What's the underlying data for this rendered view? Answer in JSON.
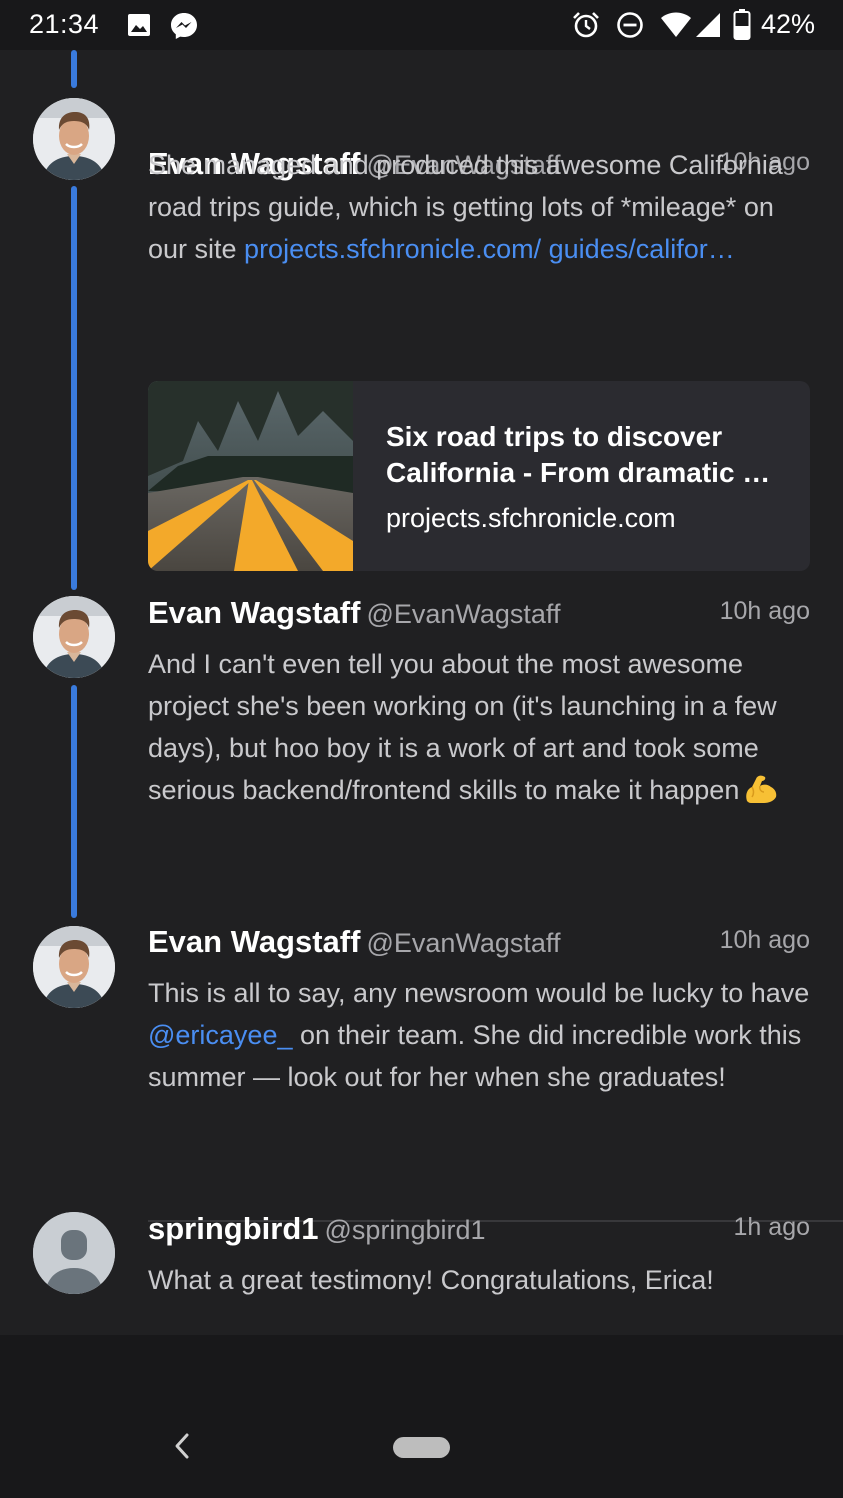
{
  "status_bar": {
    "time": "21:34",
    "battery": "42%",
    "icons": [
      "image-icon",
      "messenger-icon",
      "alarm-icon",
      "do-not-disturb-icon",
      "wifi-icon",
      "cell-signal-icon",
      "battery-icon"
    ]
  },
  "tweets": [
    {
      "name": "Evan Wagstaff",
      "handle": "@EvanWagstaff",
      "time": "10h ago",
      "text_before_link": "She managed and produced this awesome California road trips guide, which is getting lots of *mileage* on our site ",
      "link_text": "projects.sfchronicle.com/ guides/califor…",
      "card": {
        "title": "Six road trips to discover California - From dramatic …",
        "domain": "projects.sfchronicle.com"
      }
    },
    {
      "name": "Evan Wagstaff",
      "handle": "@EvanWagstaff",
      "time": "10h ago",
      "text": "And I can't even tell you about the most awesome project she's been working on (it's launching in a few days), but hoo boy it is a work of art and took some serious backend/frontend skills to make it happen"
    },
    {
      "name": "Evan Wagstaff",
      "handle": "@EvanWagstaff",
      "time": "10h ago",
      "text_before_mention": "This is all to say, any newsroom would be lucky to have ",
      "mention": "@ericayee_",
      "text_after_mention": " on their team. She did incredible work this summer — look out for her when she graduates!"
    },
    {
      "name": "springbird1",
      "handle": "@springbird1",
      "time": "1h ago",
      "text": "What a great testimony! Congratulations, Erica!"
    }
  ],
  "colors": {
    "thread_line": "#3a7bdd",
    "link": "#4a8ef2",
    "background": "#202022"
  }
}
